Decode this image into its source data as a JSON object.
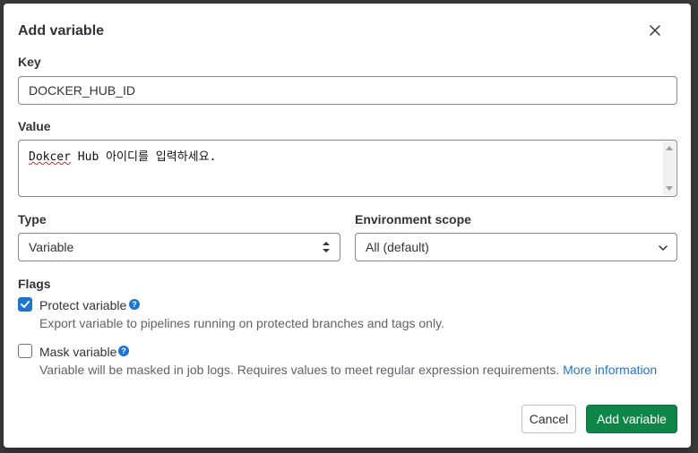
{
  "dialog": {
    "title": "Add variable",
    "close_icon": "close-icon"
  },
  "key": {
    "label": "Key",
    "value": "DOCKER_HUB_ID"
  },
  "value": {
    "label": "Value",
    "text_word1": "Dokcer",
    "text_rest": " Hub 아이디를 입력하세요."
  },
  "type": {
    "label": "Type",
    "selected": "Variable",
    "icon": "sort-arrows-icon"
  },
  "environment_scope": {
    "label": "Environment scope",
    "selected": "All (default)",
    "icon": "chevron-down-icon"
  },
  "flags": {
    "label": "Flags",
    "protect": {
      "label": "Protect variable",
      "checked": true,
      "help": "Export variable to pipelines running on protected branches and tags only."
    },
    "mask": {
      "label": "Mask variable",
      "checked": false,
      "help": "Variable will be masked in job logs. Requires values to meet regular expression requirements.",
      "link": "More information"
    }
  },
  "buttons": {
    "cancel": "Cancel",
    "add": "Add variable"
  },
  "colors": {
    "primary_blue": "#1f75cb",
    "confirm_green": "#108548"
  }
}
